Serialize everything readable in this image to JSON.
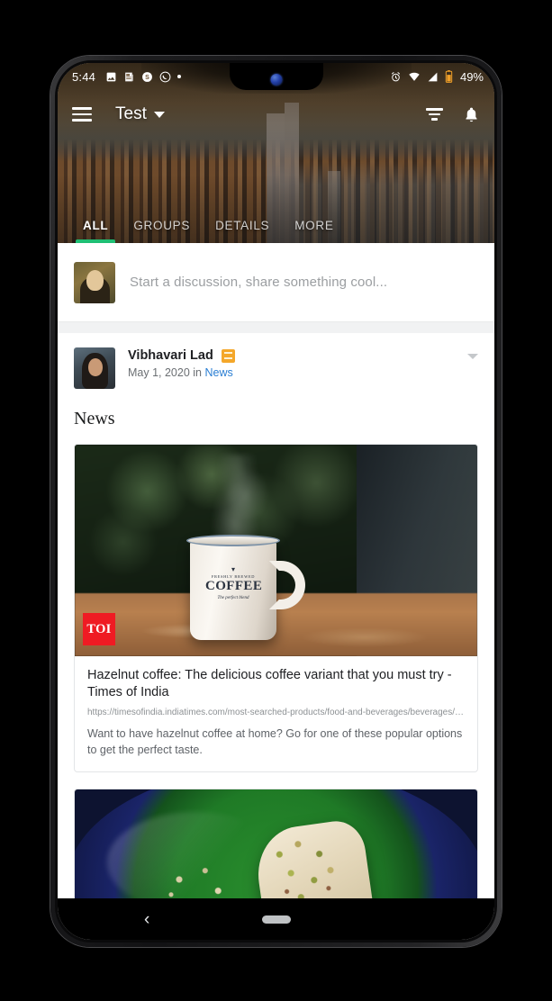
{
  "status_bar": {
    "time": "5:44",
    "battery_percent": "49%",
    "left_icons": [
      "image-icon",
      "news-icon",
      "skype-icon",
      "whatsapp-icon",
      "more-notifications-dot"
    ],
    "right_icons": [
      "alarm-icon",
      "wifi-icon",
      "signal-icon",
      "battery-icon"
    ]
  },
  "app_bar": {
    "menu_icon": "hamburger-menu-icon",
    "title": "Test",
    "dropdown_icon": "chevron-down-icon",
    "filter_icon": "filter-icon",
    "notification_icon": "bell-icon"
  },
  "tabs": [
    {
      "label": "ALL",
      "active": true
    },
    {
      "label": "GROUPS",
      "active": false
    },
    {
      "label": "DETAILS",
      "active": false
    },
    {
      "label": "MORE",
      "active": false
    }
  ],
  "composer": {
    "avatar_name": "mona-lisa-avatar",
    "placeholder": "Start a discussion, share something cool..."
  },
  "post": {
    "avatar_name": "vibhavari-lad-avatar",
    "author": "Vibhavari Lad",
    "badge_icon": "admin-badge-icon",
    "date": "May 1, 2020",
    "in_label": "in",
    "category": "News",
    "options_icon": "chevron-down-icon",
    "title": "News",
    "link_card": {
      "image_alt": "coffee-mug-photo",
      "publisher_logo": "TOI",
      "title": "Hazelnut coffee: The delicious coffee variant that you must try - Times of India",
      "url": "https://timesofindia.indiatimes.com/most-searched-products/food-and-beverages/beverages/hazelnut-cof...",
      "description": "Want to have hazelnut coffee at home? Go for one of these popular options to get the perfect taste.",
      "mug_logo": {
        "top": "FRESHLY BREWED",
        "main": "COFFEE",
        "sub": "The perfect blend"
      }
    },
    "second_card": {
      "image_alt": "pistachio-dessert-photo"
    }
  },
  "nav_bar": {
    "back_icon": "back-chevron-icon",
    "home_pill": "home-indicator-pill"
  },
  "colors": {
    "accent_green": "#1fbf74",
    "link_blue": "#2a7ed3",
    "badge_orange": "#f4a72a",
    "toi_red": "#ef1b23"
  }
}
